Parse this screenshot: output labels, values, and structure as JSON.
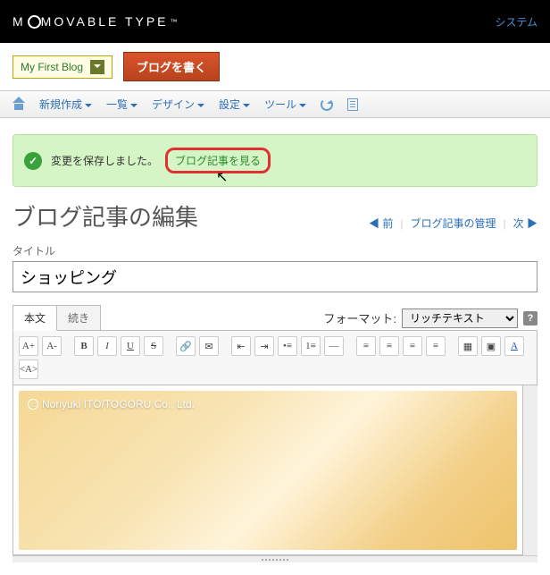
{
  "brand": {
    "name": "MOVABLE TYPE",
    "tm": "™"
  },
  "system_link": "システム",
  "blog": {
    "name": "My First Blog"
  },
  "write_button": "ブログを書く",
  "menu": {
    "new": "新規作成",
    "list": "一覧",
    "design": "デザイン",
    "settings": "設定",
    "tools": "ツール"
  },
  "notice": {
    "saved": "変更を保存しました。",
    "view_link": "ブログ記事を見る"
  },
  "page_title": "ブログ記事の編集",
  "subnav": {
    "prev": "前",
    "manage": "ブログ記事の管理",
    "next": "次"
  },
  "editor": {
    "title_label": "タイトル",
    "title_value": "ショッピング",
    "tabs": {
      "body": "本文",
      "more": "続き"
    },
    "format_label": "フォーマット:",
    "format_value": "リッチテキスト",
    "image_caption": "Noriyuki ITO/TOGORU Co., Ltd."
  },
  "toolbar_hints": {
    "fontsize_inc": "A+",
    "fontsize_dec": "A-",
    "bold": "B",
    "italic": "I",
    "underline": "U",
    "strike": "S",
    "link": "🔗",
    "mail": "✉",
    "indent_dec": "⇤",
    "indent_inc": "⇥",
    "ul": "•≡",
    "ol": "1≡",
    "hr": "—",
    "align_l": "≡",
    "align_c": "≡",
    "align_r": "≡",
    "align_j": "≡",
    "image": "▦",
    "media": "▣",
    "color": "A",
    "html": "<A>"
  }
}
